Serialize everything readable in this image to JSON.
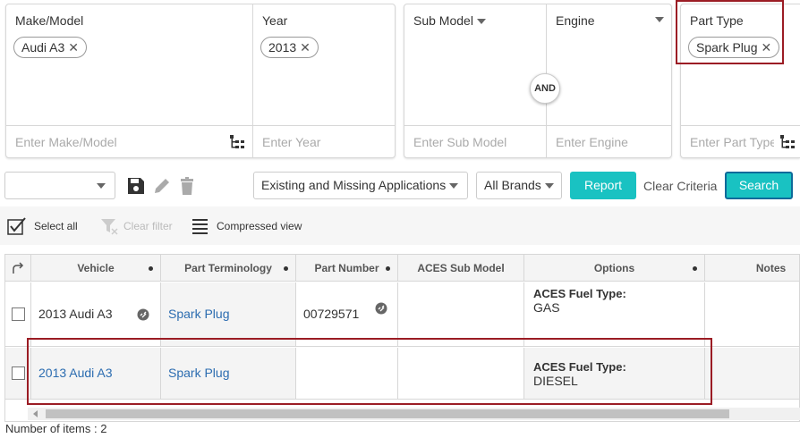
{
  "criteria": {
    "make_model": {
      "label": "Make/Model",
      "chip": "Audi A3",
      "placeholder": "Enter Make/Model",
      "tree_icon": "tree-view-icon"
    },
    "year": {
      "label": "Year",
      "chip": "2013",
      "placeholder": "Enter Year"
    },
    "sub_model": {
      "label": "Sub Model",
      "placeholder": "Enter Sub Model"
    },
    "engine": {
      "label": "Engine",
      "placeholder": "Enter Engine"
    },
    "and_label": "AND",
    "part_type": {
      "label": "Part Type",
      "chip": "Spark Plug",
      "placeholder": "Enter Part Type",
      "tree_icon": "tree-view-icon"
    },
    "chip_close": "✕"
  },
  "toolbar": {
    "save_icon": "save-icon",
    "edit_icon": "pencil-icon",
    "delete_icon": "trash-icon",
    "applications_filter": "Existing and Missing Applications",
    "brands_filter": "All Brands",
    "report_label": "Report",
    "clear_criteria_label": "Clear Criteria",
    "search_label": "Search"
  },
  "action_bar": {
    "select_all": "Select all",
    "clear_filter": "Clear filter",
    "compressed_view": "Compressed view"
  },
  "grid": {
    "columns": [
      "Vehicle",
      "Part Terminology",
      "Part Number",
      "ACES Sub Model",
      "Options",
      "Notes"
    ],
    "rows": [
      {
        "vehicle": "2013 Audi A3",
        "part_terminology": "Spark Plug",
        "part_number": "00729571",
        "aces_sub_model": "",
        "options_label": "ACES Fuel Type:",
        "options_value": "GAS",
        "notes": ""
      },
      {
        "vehicle": "2013 Audi A3",
        "part_terminology": "Spark Plug",
        "part_number": "",
        "aces_sub_model": "",
        "options_label": "ACES Fuel Type:",
        "options_value": "DIESEL",
        "notes": ""
      }
    ]
  },
  "footer": {
    "item_count": "Number of items : 2"
  },
  "colors": {
    "accent": "#19c2c2",
    "highlight": "#9b1c24",
    "link": "#2b6cb0"
  }
}
